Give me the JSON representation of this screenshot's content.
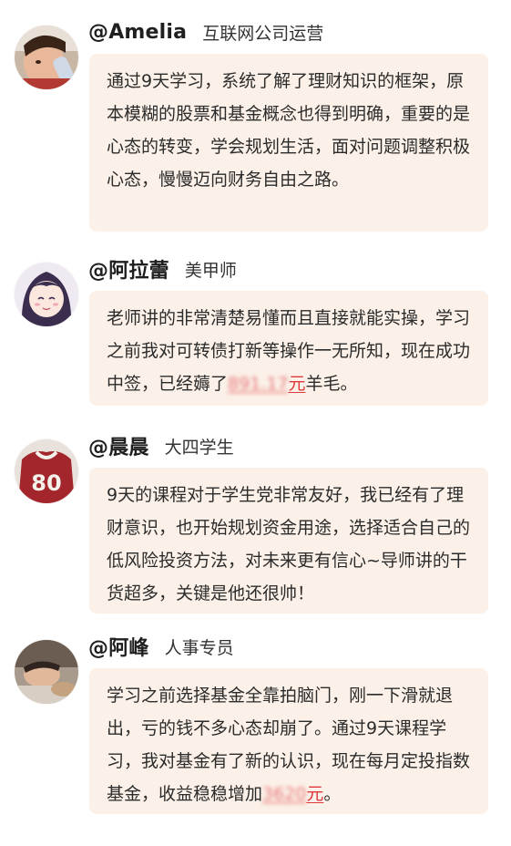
{
  "testimonials": [
    {
      "name": "@Amelia",
      "role": "互联网公司运营",
      "avatar_icon": "child-drinking-photo",
      "text": "通过9天学习，系统了解了理财知识的框架，原本模糊的股票和基金概念也得到明确，重要的是心态的转变，学会规划生活，面对问题调整积极心态，慢慢迈向财务自由之路。"
    },
    {
      "name": "@阿拉蕾",
      "role": "美甲师",
      "avatar_icon": "anime-girl-avatar",
      "text": "老师讲的非常清楚易懂而且直接就能实操，学习之前我对可转债打新等操作一无所知，现在成功中签，已经薅了",
      "amount": "891.17",
      "amount_unit": "元",
      "text_after": "羊毛。"
    },
    {
      "name": "@晨晨",
      "role": "大四学生",
      "avatar_icon": "jersey-80-avatar",
      "text": "9天的课程对于学生党非常友好，我已经有了理财意识，也开始规划资金用途，选择适合自己的低风险投资方法，对未来更有信心~导师讲的干货超多，关键是他还很帅！"
    },
    {
      "name": "@阿峰",
      "role": "人事专员",
      "avatar_icon": "sleeping-person-photo",
      "text": "学习之前选择基金全靠拍脑门，刚一下滑就退出，亏的钱不多心态却崩了。通过9天课程学习，我对基金有了新的认识，现在每月定投指数基金，收益稳稳增加",
      "amount": "3620",
      "amount_unit": "元",
      "text_after": "。"
    }
  ],
  "colors": {
    "bubble_bg": "#fbf1e8",
    "amount_red": "#e0393e",
    "text": "#2b2b2b"
  }
}
